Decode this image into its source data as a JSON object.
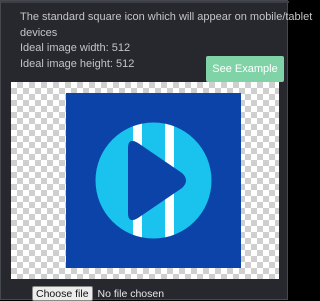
{
  "description": {
    "line1": "The standard square icon which will appear on mobile/tablet",
    "line2": "devices",
    "width_line": "Ideal image width: 512",
    "height_line": "Ideal image height: 512"
  },
  "example_button": {
    "label": "See Example",
    "color": "#7fd3a6"
  },
  "preview": {
    "icon": "play-logo-icon",
    "background_color": "#0b43a8",
    "accent_color": "#19c3ee"
  },
  "file_input": {
    "button_label": "Choose file",
    "status": "No file chosen"
  }
}
